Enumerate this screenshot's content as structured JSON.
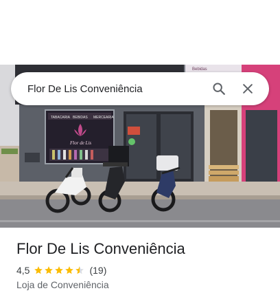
{
  "search": {
    "query": "Flor De Lis Conveniência"
  },
  "place": {
    "name": "Flor De Lis Conveniência",
    "rating": 4.5,
    "rating_text": "4,5",
    "reviews_text": "(19)",
    "category": "Loja de Conveniência"
  },
  "photo": {
    "signs": {
      "tabacaria": "TABACARIA",
      "bebidas": "BEBIDAS",
      "mercearia": "MERCEARIA",
      "window_brand": "Flor de Lis",
      "right_sign": "Bebidas"
    }
  },
  "colors": {
    "star": "#fbbc04",
    "star_empty": "#dadce0",
    "icon": "#5f6368",
    "accent_pink": "#d6417a"
  },
  "icons": {
    "search": "search-icon",
    "close": "close-icon",
    "star": "star-icon"
  }
}
